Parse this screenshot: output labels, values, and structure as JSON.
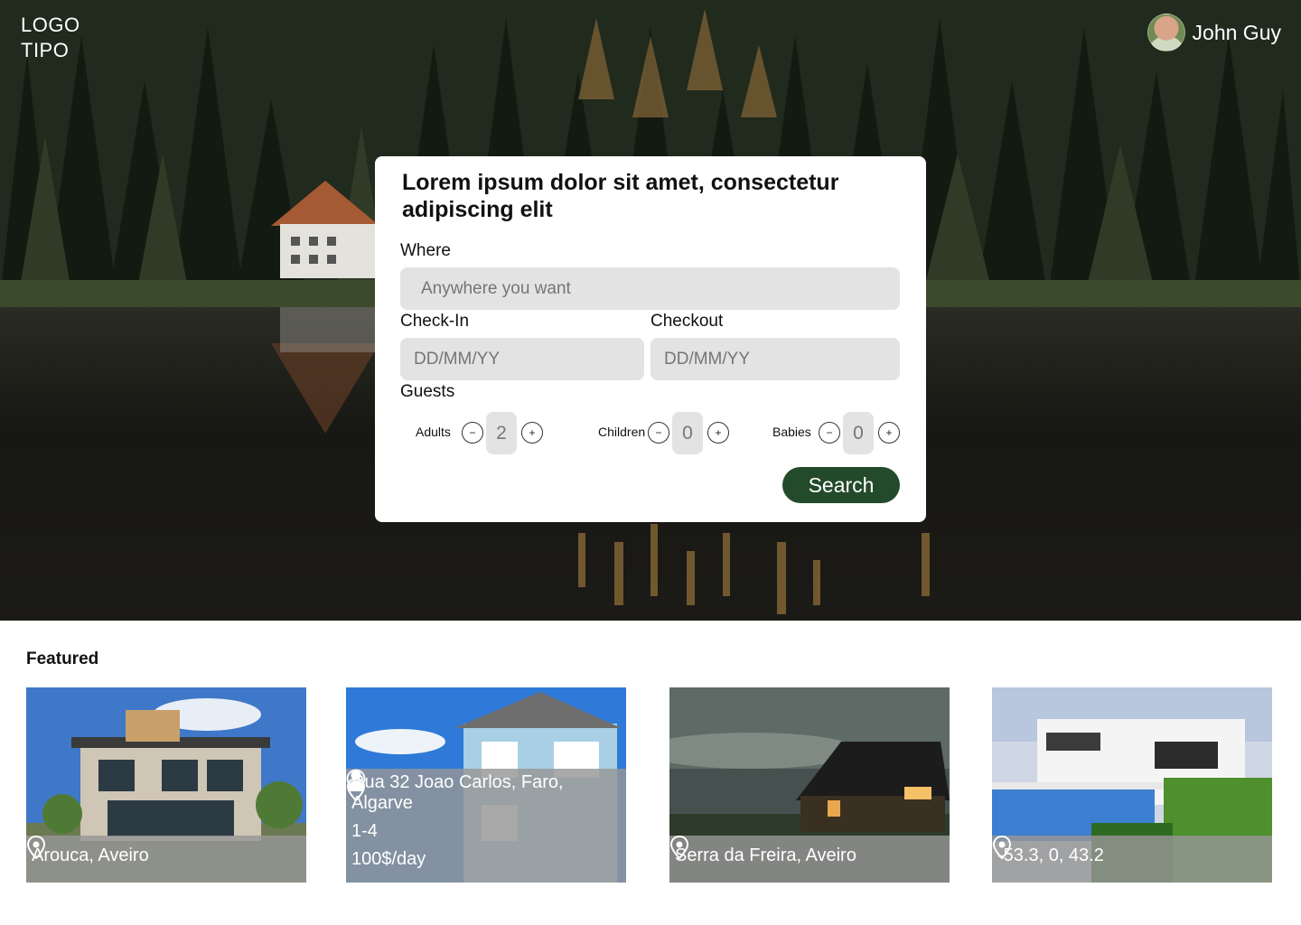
{
  "header": {
    "logo_line1": "LOGO",
    "logo_line2": "TIPO",
    "user_name": "John Guy"
  },
  "search": {
    "title": "Lorem ipsum dolor sit amet, consectetur adipiscing elit",
    "where_label": "Where",
    "where_placeholder": "Anywhere you want",
    "checkin_label": "Check-In",
    "checkin_placeholder": "DD/MM/YY",
    "checkout_label": "Checkout",
    "checkout_placeholder": "DD/MM/YY",
    "guests_label": "Guests",
    "guests": [
      {
        "label": "Adults",
        "value": "2"
      },
      {
        "label": "Children",
        "value": "0"
      },
      {
        "label": "Babies",
        "value": "0"
      }
    ],
    "minus": "−",
    "plus": "+",
    "search_label": "Search"
  },
  "featured": {
    "title": "Featured",
    "items": [
      {
        "location": "Arouca, Aveiro"
      },
      {
        "location": "Rua 32 Joao Carlos, Faro, Algarve",
        "guests": "1-4",
        "price": "100$/day"
      },
      {
        "location": "Serra da Freira, Aveiro"
      },
      {
        "location": "-53.3, 0, 43.2"
      }
    ]
  },
  "colors": {
    "accent": "#234a2a",
    "field_bg": "#e3e3e3",
    "caption_bg": "#969696"
  },
  "icons": [
    "location-pin-icon",
    "person-icon",
    "dollar-icon"
  ]
}
